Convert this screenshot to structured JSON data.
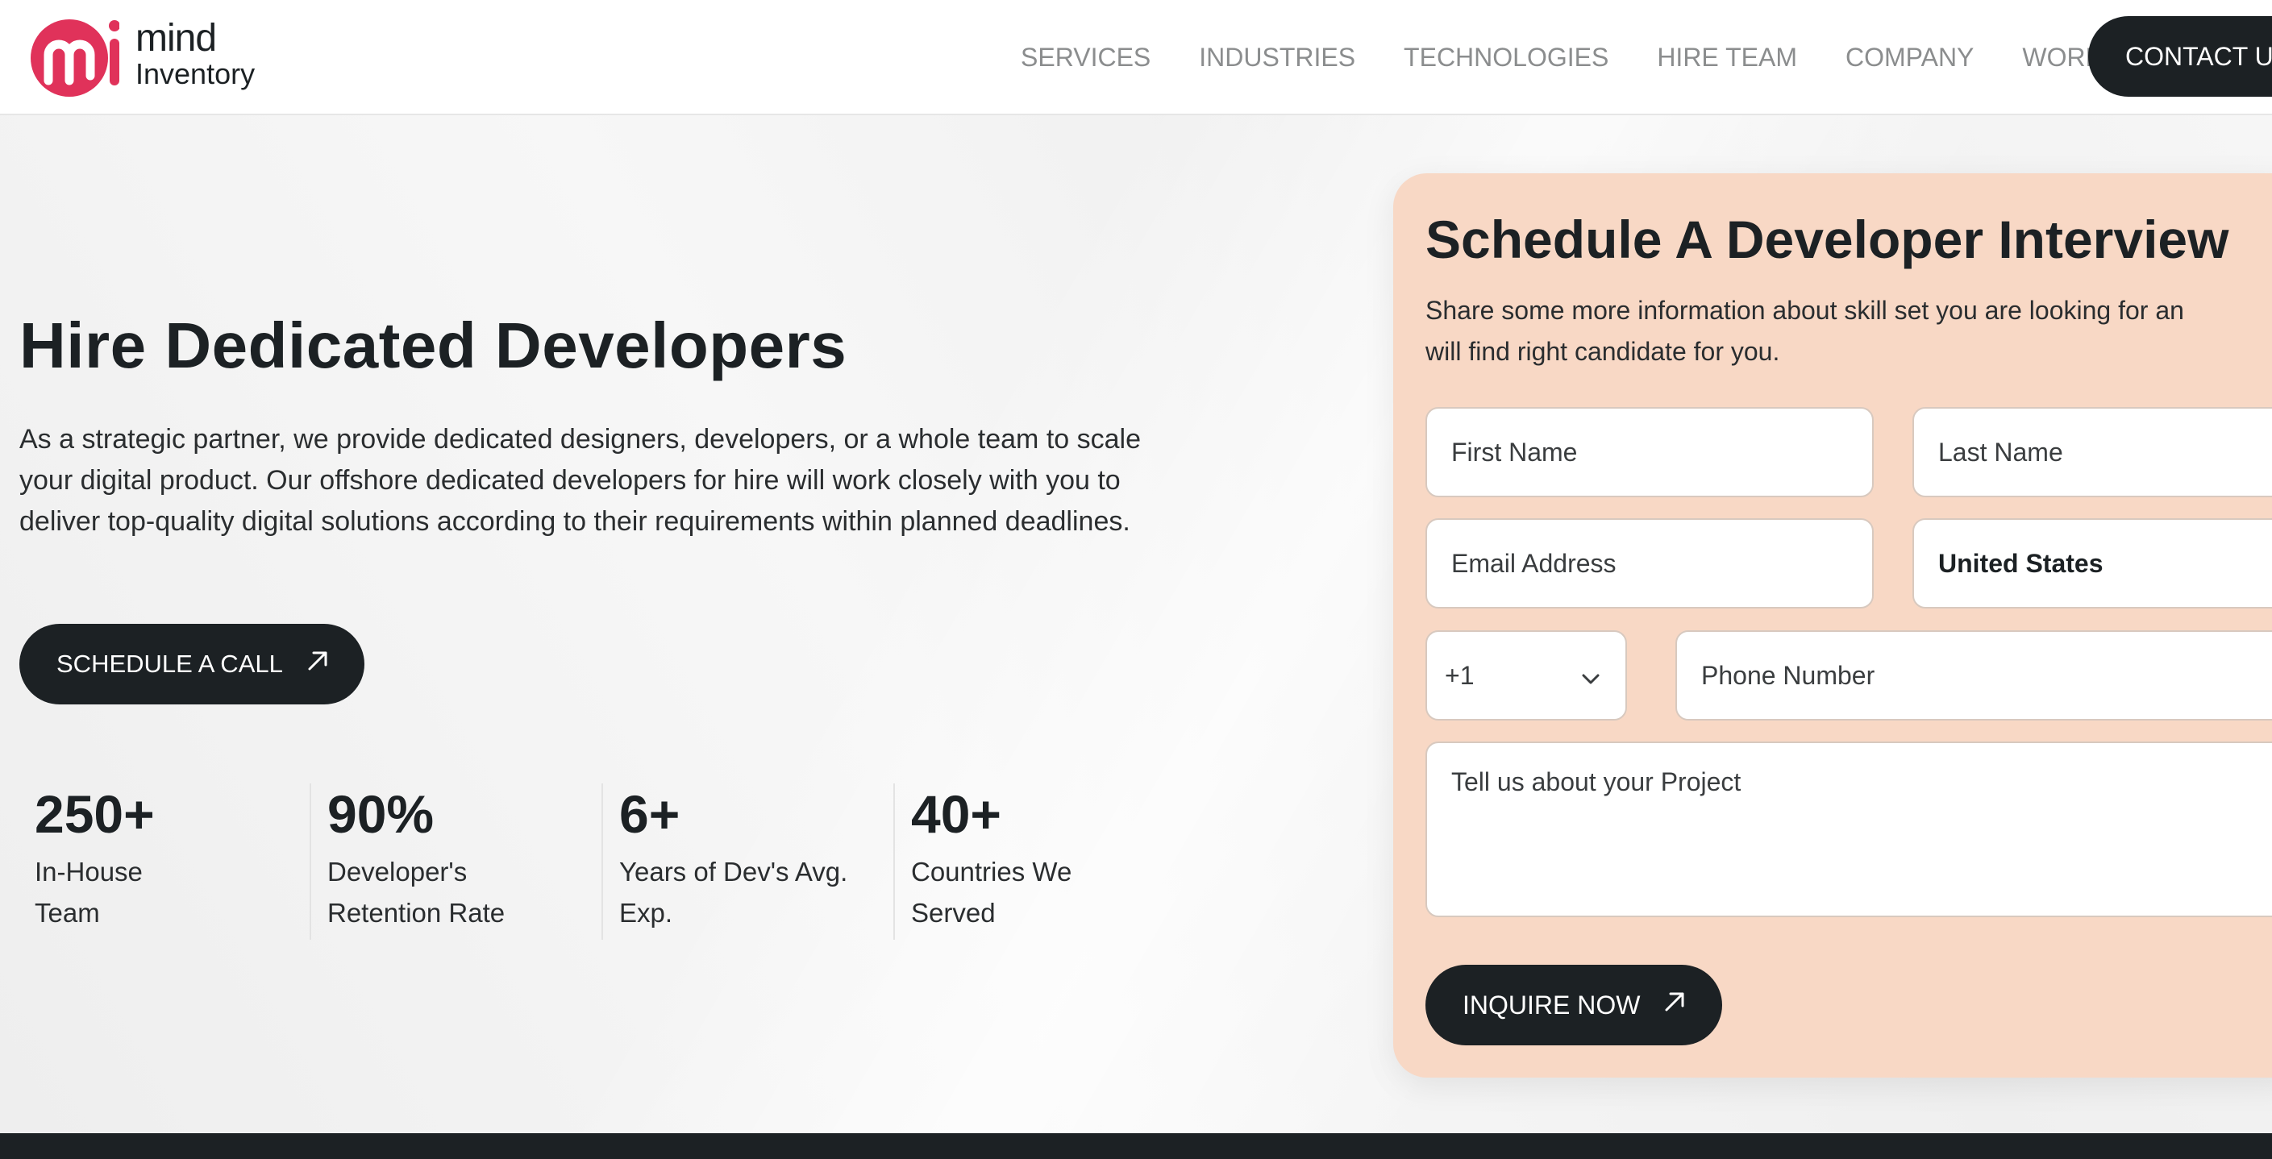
{
  "header": {
    "logo": {
      "line1": "mind",
      "line2": "Inventory",
      "icon": "mi-logo-icon",
      "brand_color": "#e0325a"
    },
    "nav": [
      "SERVICES",
      "INDUSTRIES",
      "TECHNOLOGIES",
      "HIRE TEAM",
      "COMPANY",
      "WORK"
    ],
    "contact_label": "CONTACT U"
  },
  "hero": {
    "title": "Hire Dedicated Developers",
    "description": "As a strategic partner, we provide dedicated designers, developers, or a whole team to scale your digital product. Our offshore dedicated developers for hire will work closely with you to deliver top-quality digital solutions according to their requirements within planned deadlines.",
    "cta_label": "SCHEDULE A CALL",
    "cta_icon": "arrow-up-right-icon",
    "stats": [
      {
        "value": "250+",
        "label_line1": "In-House",
        "label_line2": "Team"
      },
      {
        "value": "90%",
        "label_line1": "Developer's",
        "label_line2": "Retention Rate"
      },
      {
        "value": "6+",
        "label_line1": "Years of Dev's Avg.",
        "label_line2": "Exp."
      },
      {
        "value": "40+",
        "label_line1": "Countries We",
        "label_line2": "Served"
      }
    ]
  },
  "form": {
    "title": "Schedule A Developer Interview",
    "description_line1": "Share some more information about skill set you are looking for an",
    "description_line2": "will find right candidate for you.",
    "first_name_placeholder": "First Name",
    "last_name_placeholder": "Last Name",
    "email_placeholder": "Email Address",
    "country_value": "United States",
    "dial_code_value": "+1",
    "phone_placeholder": "Phone Number",
    "project_placeholder": "Tell us about your Project",
    "submit_label": "INQUIRE NOW",
    "card_color": "#f8d8c5"
  },
  "colors": {
    "dark": "#1c2124",
    "nav_text": "#8b8d8e",
    "accent": "#e0325a"
  }
}
